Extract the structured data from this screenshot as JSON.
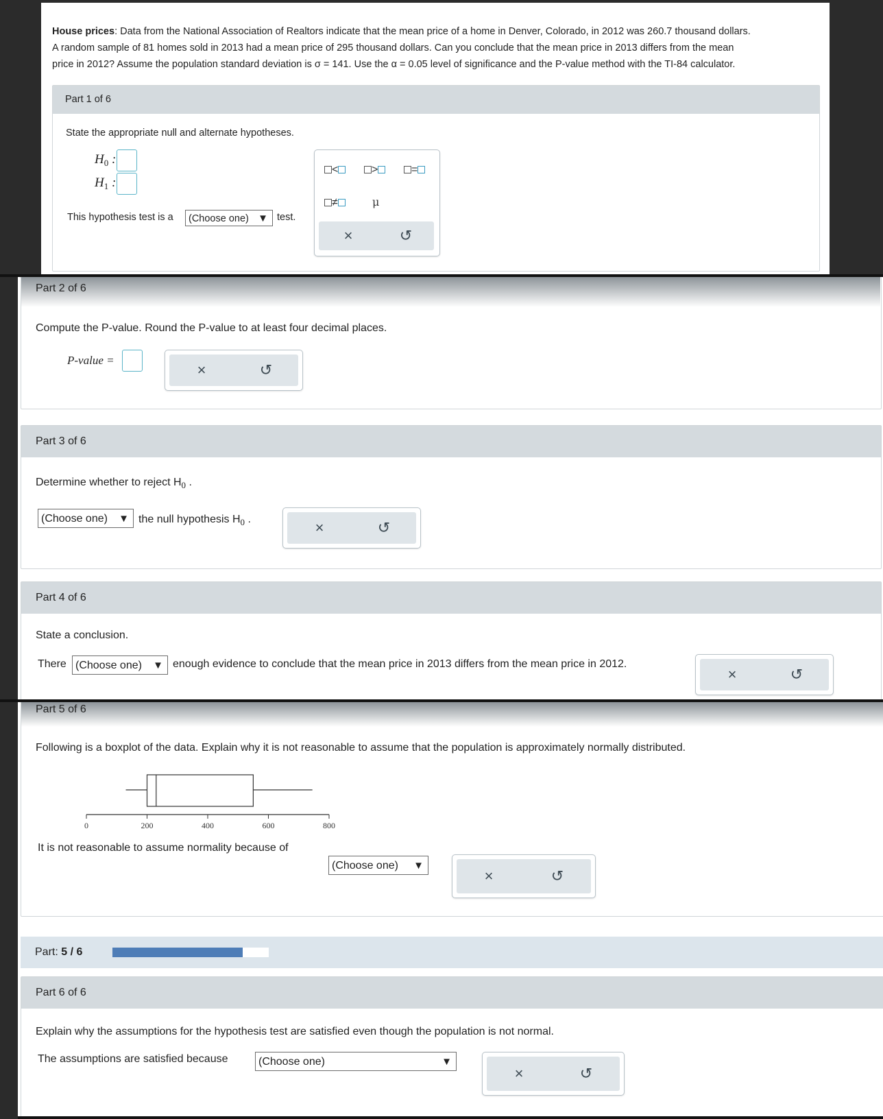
{
  "problem": {
    "bold_label": "House prices",
    "line1": ": Data from the National Association of Realtors indicate that the mean price of a home in Denver, Colorado, in 2012 was 260.7 thousand dollars.",
    "line2": "A random sample of 81 homes sold in 2013 had a mean price of 295 thousand dollars. Can you conclude that the mean price in 2013 differs from the mean",
    "line3": "price in 2012? Assume the population standard deviation is σ = 141. Use the α = 0.05 level of significance and the P-value method with the TI-84 calculator."
  },
  "part1": {
    "header": "Part 1 of 6",
    "instruction": "State the appropriate null and alternate hypotheses.",
    "h0": "H",
    "h0_sub": "0",
    "h1": "H",
    "h1_sub": "1",
    "test_prefix": "This hypothesis test is a",
    "test_select": "(Choose one)",
    "test_suffix": "test.",
    "palette": {
      "lt": "<",
      "gt": ">",
      "eq": "=",
      "ne": "≠",
      "mu": "μ"
    }
  },
  "part2": {
    "header": "Part 2 of 6",
    "instruction": "Compute the P-value. Round the P-value to at least four decimal places.",
    "pvalue_label": "P-value ="
  },
  "part3": {
    "header": "Part 3 of 6",
    "instruction": "Determine whether to reject H",
    "instruction_sub": "0",
    "select": "(Choose one)",
    "suffix": "the null hypothesis H",
    "suffix_sub": "0"
  },
  "part4": {
    "header": "Part 4 of 6",
    "instruction": "State a conclusion.",
    "prefix": "There",
    "select": "(Choose one)",
    "suffix": "enough evidence to conclude that the mean price in 2013 differs from the mean price in 2012."
  },
  "part5": {
    "header": "Part 5 of 6",
    "instruction": "Following is a boxplot of the data. Explain why it is not reasonable to assume that the population is approximately normally distributed.",
    "prefix": "It is not reasonable to assume normality because of",
    "select": "(Choose one)"
  },
  "chart_data": {
    "type": "boxplot",
    "title": "",
    "xlabel": "",
    "ticks": [
      "0",
      "200",
      "400",
      "600",
      "800"
    ],
    "xlim": [
      0,
      800
    ],
    "whisker_low": 130,
    "q1": 200,
    "median": 230,
    "q3": 550,
    "whisker_high": 745
  },
  "progress": {
    "label": "Part:",
    "value": "5 / 6",
    "fraction": 0.833
  },
  "part6": {
    "header": "Part 6 of 6",
    "instruction": "Explain why the assumptions for the hypothesis test are satisfied even though the population is not normal.",
    "prefix": "The assumptions are satisfied because",
    "select": "(Choose one)"
  },
  "icons": {
    "clear": "×",
    "undo": "↺",
    "dropdown": "▼"
  }
}
